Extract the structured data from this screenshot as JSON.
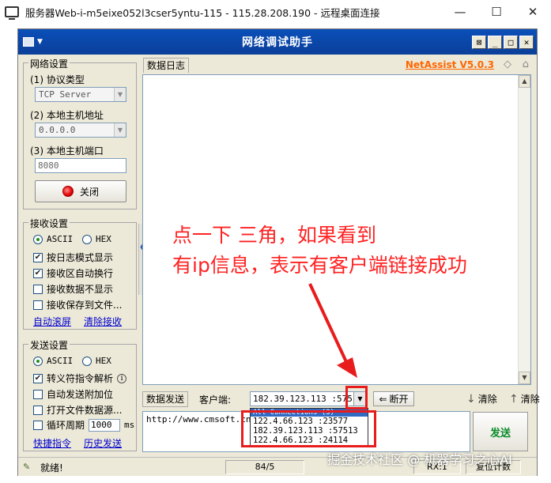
{
  "rdp": {
    "title": "服务器Web-i-m5eixe052l3cser5yntu-115 - 115.28.208.190 - 远程桌面连接",
    "minimize_glyph": "—",
    "maximize_glyph": "☐",
    "close_glyph": "✕"
  },
  "app": {
    "title": "网络调试助手",
    "window_buttons": [
      "⊠",
      "_",
      "□",
      "✕"
    ]
  },
  "network_settings": {
    "legend": "网络设置",
    "protocol_label": "(1) 协议类型",
    "protocol_value": "TCP Server",
    "host_label": "(2) 本地主机地址",
    "host_value": "0.0.0.0",
    "port_label": "(3) 本地主机端口",
    "port_value": "8080",
    "close_button": "关闭"
  },
  "receive_settings": {
    "legend": "接收设置",
    "ascii": "ASCII",
    "hex": "HEX",
    "options": [
      {
        "label": "按日志模式显示",
        "checked": true
      },
      {
        "label": "接收区自动换行",
        "checked": true
      },
      {
        "label": "接收数据不显示",
        "checked": false
      },
      {
        "label": "接收保存到文件...",
        "checked": false
      }
    ],
    "auto_scroll": "自动滚屏",
    "clear_receive": "清除接收"
  },
  "send_settings": {
    "legend": "发送设置",
    "ascii": "ASCII",
    "hex": "HEX",
    "options": [
      {
        "label": "转义符指令解析",
        "checked": true
      },
      {
        "label": "自动发送附加位",
        "checked": false
      },
      {
        "label": "打开文件数据源...",
        "checked": false
      }
    ],
    "loop_label": "循环周期",
    "loop_value": "1000",
    "loop_unit": "ms",
    "shortcut": "快捷指令",
    "history": "历史发送"
  },
  "log": {
    "tab": "数据日志",
    "brand": "NetAssist V5.0.3"
  },
  "send_bar": {
    "tab": "数据发送",
    "client_label": "客户端:",
    "client_value": "182.39.123.113 :57513",
    "disconnect": "断开",
    "clear1": "清除",
    "clear2": "清除",
    "send_text": "http://www.cmsoft.cn",
    "send_button": "发送"
  },
  "dropdown": {
    "selected": "All Connections (3)",
    "items": [
      "122.4.66.123 :23577",
      "182.39.123.113 :57513",
      "122.4.66.123 :24114"
    ]
  },
  "status": {
    "ready": "就绪!",
    "counter": "84/5",
    "rx": "RX:1",
    "reset": "复位计数"
  },
  "annotation": {
    "line1": "点一下 三角，如果看到",
    "line2": "有ip信息，表示有客户端链接成功"
  },
  "watermark": "掘金技术社区 @ 机器学习之心AI"
}
